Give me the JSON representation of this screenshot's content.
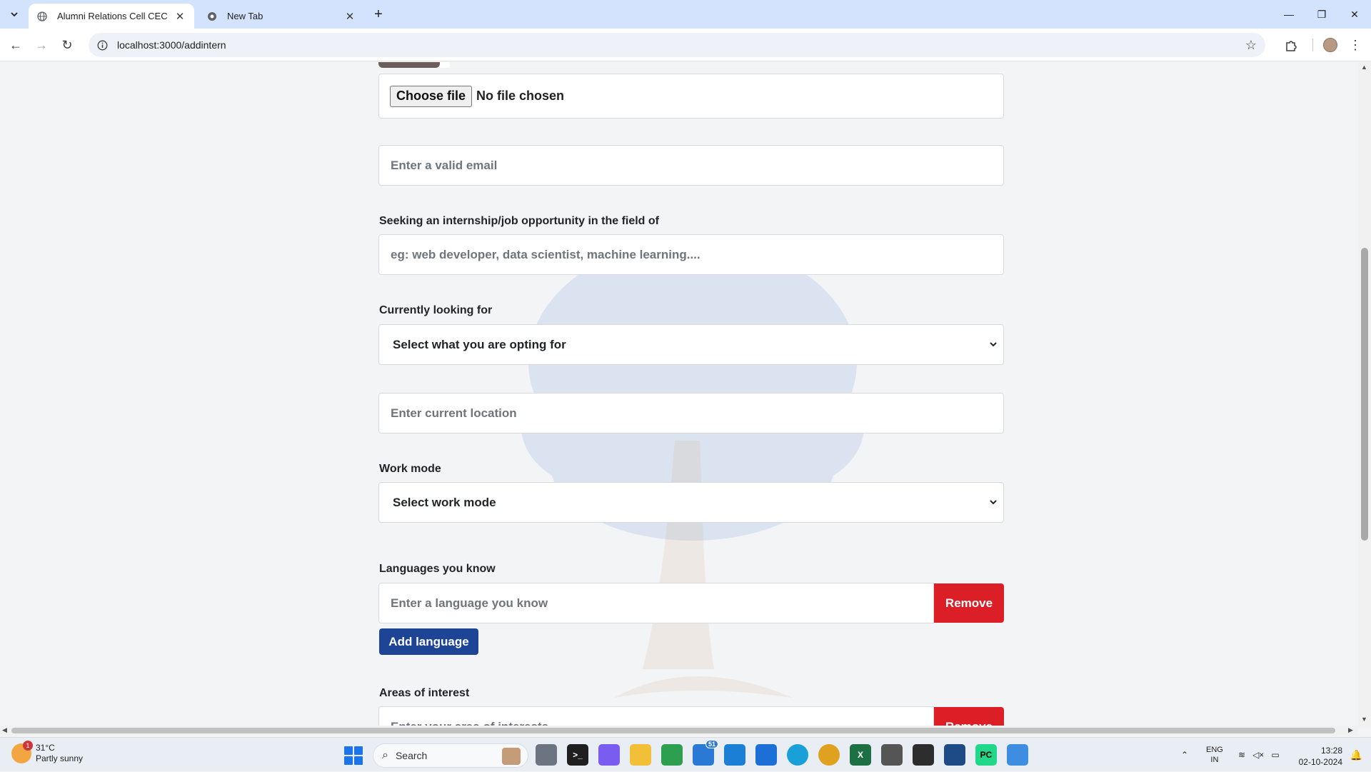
{
  "browser": {
    "tabs": [
      {
        "title": "Alumni Relations Cell CEC",
        "active": true
      },
      {
        "title": "New Tab",
        "active": false
      }
    ],
    "url": "localhost:3000/addintern"
  },
  "form": {
    "file": {
      "button_label": "Choose file",
      "status": "No file chosen"
    },
    "email_placeholder": "Enter a valid email",
    "field_label": "Seeking an internship/job opportunity in the field of",
    "field_placeholder": "eg: web developer, data scientist, machine learning....",
    "looking_label": "Currently looking for",
    "looking_value": "Select what you are opting for",
    "location_placeholder": "Enter current location",
    "workmode_label": "Work mode",
    "workmode_value": "Select work mode",
    "languages_label": "Languages you know",
    "language_placeholder": "Enter a language you know",
    "remove_label": "Remove",
    "add_language_label": "Add language",
    "interests_label": "Areas of interest",
    "interest_placeholder": "Enter your area of interests",
    "interest_remove_label": "Remove"
  },
  "taskbar": {
    "weather_temp": "31°C",
    "weather_desc": "Partly sunny",
    "weather_badge": "1",
    "search_label": "Search",
    "mail_badge": "51",
    "lang_top": "ENG",
    "lang_bottom": "IN",
    "time": "13:28",
    "date": "02-10-2024"
  },
  "colors": {
    "remove": "#dc1f26",
    "add_language": "#1e4595",
    "tabbar": "#d3e3fd"
  }
}
